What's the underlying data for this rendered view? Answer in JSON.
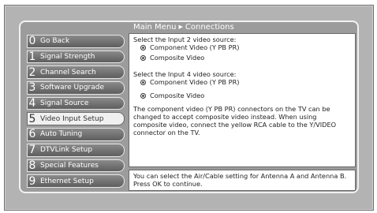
{
  "breadcrumb": {
    "root": "Main Menu",
    "current": "Connections"
  },
  "menu": {
    "items": [
      {
        "num": "0",
        "label": "Go Back"
      },
      {
        "num": "1",
        "label": "Signal Strength"
      },
      {
        "num": "2",
        "label": "Channel Search"
      },
      {
        "num": "3",
        "label": "Software Upgrade"
      },
      {
        "num": "4",
        "label": "Signal Source"
      },
      {
        "num": "5",
        "label": "Video Input Setup"
      },
      {
        "num": "6",
        "label": "Auto Tuning"
      },
      {
        "num": "7",
        "label": "DTVLink Setup"
      },
      {
        "num": "8",
        "label": "Special Features"
      },
      {
        "num": "9",
        "label": "Ethernet Setup"
      }
    ],
    "selected_index": 5
  },
  "content": {
    "input2_prompt": "Select the Input 2 video source:",
    "input2_option1": "Component Video (Y PB PR)",
    "input2_option2": "Composite Video",
    "input4_prompt": "Select the Input 4 video source:",
    "input4_option1": "Component Video (Y PB PR)",
    "input4_option2": "Composite Video",
    "info": "The component video (Y PB PR) connectors on the TV can be changed to accept composite video instead. When using composite video, connect the yellow RCA cable to the Y/VIDEO connector on the TV."
  },
  "footer": {
    "text": "You can select the Air/Cable setting for Antenna A and Antenna B. Press OK to continue."
  }
}
